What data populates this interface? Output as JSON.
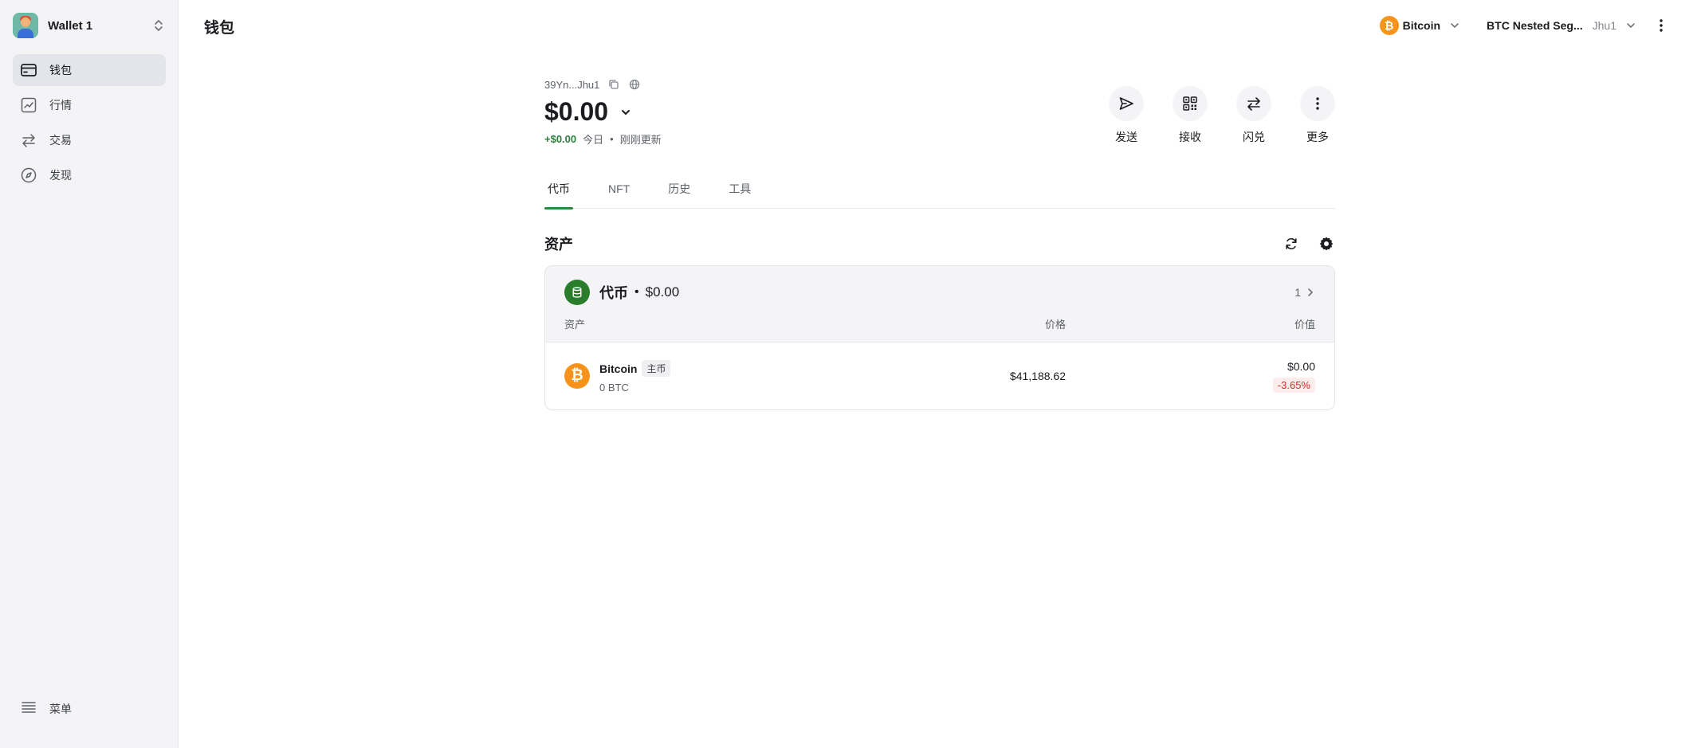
{
  "sidebar": {
    "wallet_name": "Wallet 1",
    "nav": [
      {
        "label": "钱包",
        "icon": "wallet-icon",
        "active": true
      },
      {
        "label": "行情",
        "icon": "chart-line-icon",
        "active": false
      },
      {
        "label": "交易",
        "icon": "swap-arrows-icon",
        "active": false
      },
      {
        "label": "发现",
        "icon": "compass-icon",
        "active": false
      }
    ],
    "menu_label": "菜单"
  },
  "header": {
    "title": "钱包",
    "network": {
      "name": "Bitcoin",
      "symbol": "₿"
    },
    "account": {
      "name": "BTC Nested Seg...",
      "suffix": "Jhu1"
    }
  },
  "overview": {
    "address": "39Yn...Jhu1",
    "balance": "$0.00",
    "change_value": "+$0.00",
    "change_label": "今日",
    "separator": "•",
    "updated": "刚刚更新"
  },
  "actions": [
    {
      "label": "发送",
      "icon": "send-icon"
    },
    {
      "label": "接收",
      "icon": "qr-code-icon"
    },
    {
      "label": "闪兑",
      "icon": "swap-icon"
    },
    {
      "label": "更多",
      "icon": "more-vertical-icon"
    }
  ],
  "tabs": [
    {
      "label": "代币",
      "active": true
    },
    {
      "label": "NFT",
      "active": false
    },
    {
      "label": "历史",
      "active": false
    },
    {
      "label": "工具",
      "active": false
    }
  ],
  "assets": {
    "title": "资产",
    "group": {
      "name": "代币",
      "separator": "•",
      "value": "$0.00",
      "count": "1"
    },
    "columns": {
      "asset": "资产",
      "price": "价格",
      "value": "价值"
    },
    "rows": [
      {
        "name": "Bitcoin",
        "badge": "主币",
        "amount": "0 BTC",
        "price": "$41,188.62",
        "value": "$0.00",
        "change": "-3.65%",
        "symbol": "₿"
      }
    ]
  },
  "colors": {
    "accent_green": "#2a8a3e",
    "bitcoin_orange": "#f7931a",
    "negative_red": "#d02b2b"
  }
}
